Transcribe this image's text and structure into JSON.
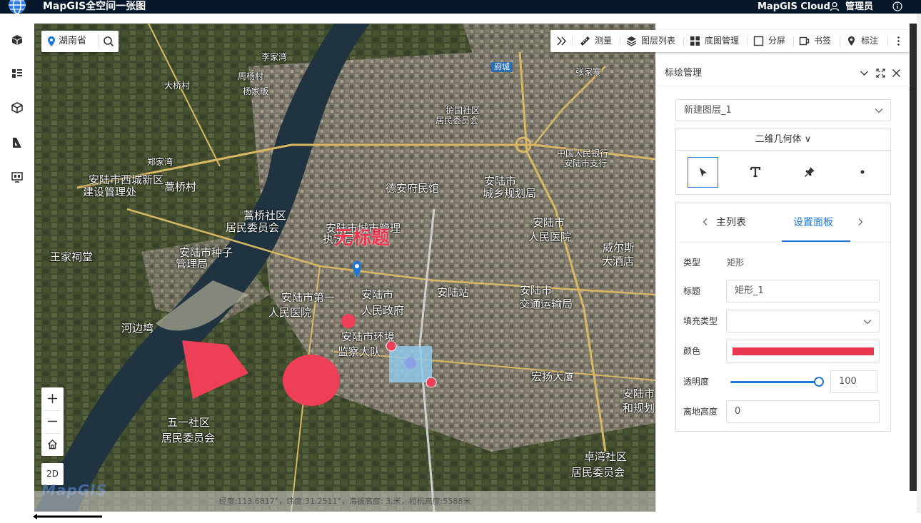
{
  "header": {
    "app_title": "MapGIS全空间一张图",
    "cloud_label": "MapGIS Cloud",
    "user_name": "管理员"
  },
  "rail": {
    "items": [
      "cube-icon",
      "list-icon",
      "layers-cube-icon",
      "measure-icon",
      "screen-icon"
    ]
  },
  "search": {
    "region": "湖南省"
  },
  "toolbar": {
    "collapse_icon": "double-chevron-icon",
    "items": [
      {
        "label": "测量",
        "icon": "ruler-icon"
      },
      {
        "label": "图层列表",
        "icon": "layers-icon"
      },
      {
        "label": "底图管理",
        "icon": "grid-icon"
      },
      {
        "label": "分屏",
        "icon": "split-icon"
      },
      {
        "label": "书签",
        "icon": "bookmark-icon"
      },
      {
        "label": "标注",
        "icon": "marker-icon"
      }
    ]
  },
  "map": {
    "labels": [
      "李家湾",
      "周杨村",
      "大桥村",
      "杨家畈",
      "护国社区",
      "居民委员会",
      "府城",
      "张家寨",
      "郑家湾",
      "中国人民银行",
      "安陆市支行",
      "安陆市西城新区",
      "建设管理处",
      "蒿桥村",
      "德安府民馆",
      "安陆市",
      "城乡规划局",
      "蒿桥社区",
      "居民委员会",
      "安陆市城市管理",
      "执法局",
      "安陆市",
      "人民医院",
      "威尔斯",
      "大酒店",
      "王家祠堂",
      "安陆市种子",
      "管理局",
      "安陆市第一",
      "人民医院",
      "安陆市",
      "人民政府",
      "安陆站",
      "安陆市",
      "交通运输局",
      "河边塆",
      "安陆市环境",
      "监察大队",
      "宏扬大厦",
      "安陆市",
      "和规划",
      "五一社区",
      "居民委员会",
      "卓湾社区",
      "居民委员会"
    ],
    "annotation_text": "无标题",
    "status_text": "经度:113.6817°，纬度:31.2511°，海拔高度: 3,米，相机高度:5588米",
    "watermark": "MapGIS",
    "zoom_in_icon": "plus-icon",
    "zoom_out_icon": "minus-icon",
    "home_icon": "home-icon",
    "mode_button": "2D"
  },
  "panel": {
    "title": "标绘管理",
    "layer_select": "新建图层_1",
    "geometry_type": "二维几何体 ∨",
    "tools": [
      "cursor-icon",
      "text-icon",
      "pin-icon",
      "dot-icon"
    ],
    "tab_main_list": "主列表",
    "tab_settings": "设置面板",
    "fields": {
      "type_label": "类型",
      "type_value": "矩形",
      "title_label": "标题",
      "title_value": "矩形_1",
      "fill_type_label": "填充类型",
      "fill_type_value": "",
      "color_label": "颜色",
      "color_value": "#e8364f",
      "opacity_label": "透明度",
      "opacity_value": "100",
      "height_label": "离地高度",
      "height_value": "0"
    }
  }
}
